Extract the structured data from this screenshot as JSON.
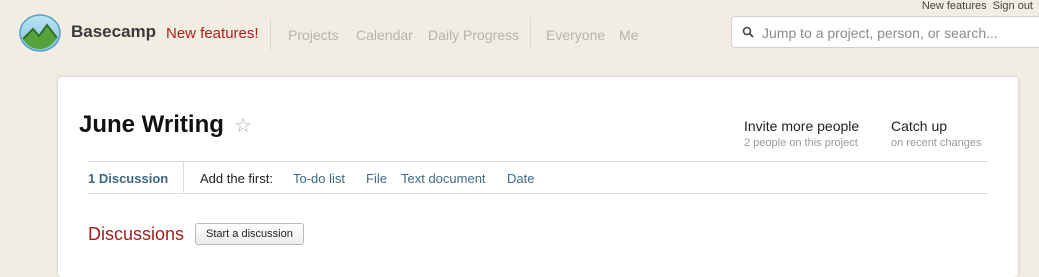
{
  "top_links": {
    "new_features": "New features",
    "sign_out": "Sign out"
  },
  "header": {
    "brand": "Basecamp",
    "new_features": "New features!",
    "nav": [
      "Projects",
      "Calendar",
      "Daily Progress",
      "Everyone",
      "Me"
    ]
  },
  "search": {
    "placeholder": "Jump to a project, person, or search..."
  },
  "project": {
    "title": "June Writing",
    "invite": {
      "label": "Invite more people",
      "sub": "2 people on this project"
    },
    "catchup": {
      "label": "Catch up",
      "sub": "on recent changes"
    }
  },
  "tabs": {
    "discussion_count": "1 Discussion",
    "add_first": "Add the first:",
    "links": [
      "To-do list",
      "File",
      "Text document",
      "Date"
    ]
  },
  "discussions": {
    "heading": "Discussions",
    "start_button": "Start a discussion"
  },
  "colors": {
    "accent_red": "#b21d18",
    "link_blue": "#3c6a86",
    "background": "#f1ede3"
  }
}
